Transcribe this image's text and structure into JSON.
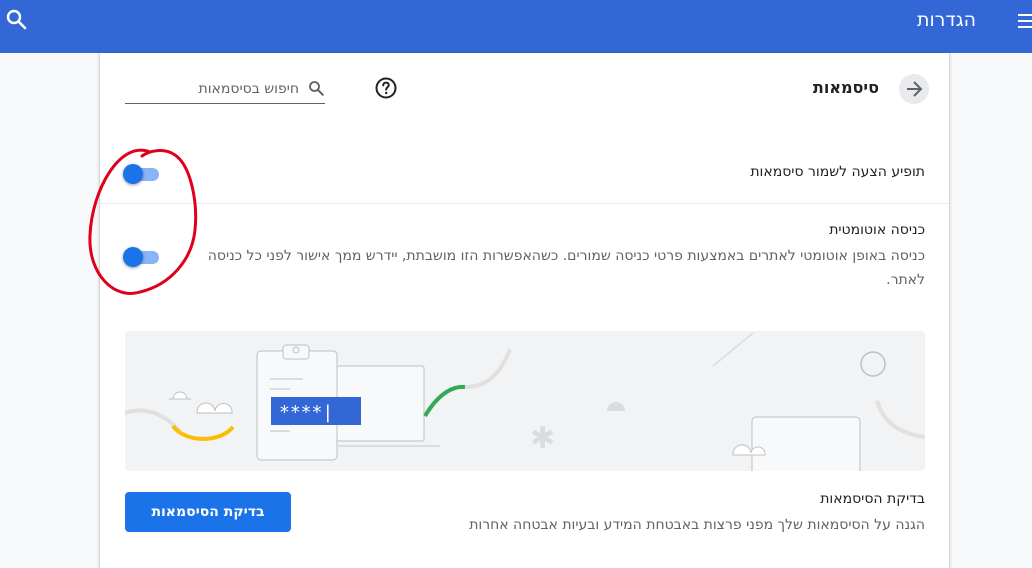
{
  "app": {
    "title": "הגדרות"
  },
  "header": {
    "page_title": "סיסמאות",
    "search_placeholder": "חיפוש בסיסמאות"
  },
  "settings": {
    "offer_to_save": {
      "label": "תופיע הצעה לשמור סיסמאות",
      "enabled": true
    },
    "auto_signin": {
      "label": "כניסה אוטומטית",
      "description": "כניסה באופן אוטומטי לאתרים באמצעות פרטי כניסה שמורים. כשהאפשרות הזו מושבתת, יידרש ממך אישור לפני כל כניסה לאתר.",
      "enabled": true
    }
  },
  "illustration": {
    "password_mask": "****|"
  },
  "password_check": {
    "title": "בדיקת הסיסמאות",
    "description": "הגנה על הסיסמאות שלך מפני פרצות באבטחת המידע ובעיות אבטחה אחרות",
    "button_label": "בדיקת הסיסמאות"
  },
  "colors": {
    "toolbar": "#3367d6",
    "accent": "#1a73e8",
    "annotation": "#e0001b"
  },
  "icons": {
    "menu": "menu-icon",
    "search": "search-icon",
    "back": "arrow-back-icon",
    "help": "help-icon"
  }
}
